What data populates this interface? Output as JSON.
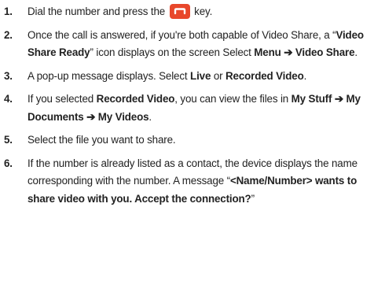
{
  "steps": [
    {
      "num": "1.",
      "parts": [
        {
          "t": "Dial the number and press the "
        },
        {
          "icon": "send-key-icon"
        },
        {
          "t": " key."
        }
      ]
    },
    {
      "num": "2.",
      "parts": [
        {
          "t": "Once the call is answered, if you're both capable of Video Share, a “"
        },
        {
          "t": "Video Share Ready",
          "b": true
        },
        {
          "t": "” icon displays on the screen Select "
        },
        {
          "t": "Menu ➔ Video Share",
          "b": true
        },
        {
          "t": "."
        }
      ]
    },
    {
      "num": "3.",
      "parts": [
        {
          "t": "A pop-up message displays. Select "
        },
        {
          "t": "Live",
          "b": true
        },
        {
          "t": " or "
        },
        {
          "t": "Recorded Video",
          "b": true
        },
        {
          "t": "."
        }
      ]
    },
    {
      "num": "4.",
      "parts": [
        {
          "t": "If you selected "
        },
        {
          "t": "Recorded Video",
          "b": true
        },
        {
          "t": ", you can view the files in "
        },
        {
          "t": "My Stuff ➔ My Documents ➔ My Videos",
          "b": true
        },
        {
          "t": "."
        }
      ]
    },
    {
      "num": "5.",
      "parts": [
        {
          "t": "Select the file you want to share."
        }
      ]
    },
    {
      "num": "6.",
      "parts": [
        {
          "t": "If the number is already listed as a contact, the device displays the name corresponding with the number. A message “"
        },
        {
          "t": "<Name/Number> wants to share video with you. Accept the connection?",
          "b": true
        },
        {
          "t": "”"
        }
      ]
    }
  ],
  "colors": {
    "text": "#222222",
    "icon_bg": "#e8472b",
    "icon_glyph": "#ffffff"
  }
}
